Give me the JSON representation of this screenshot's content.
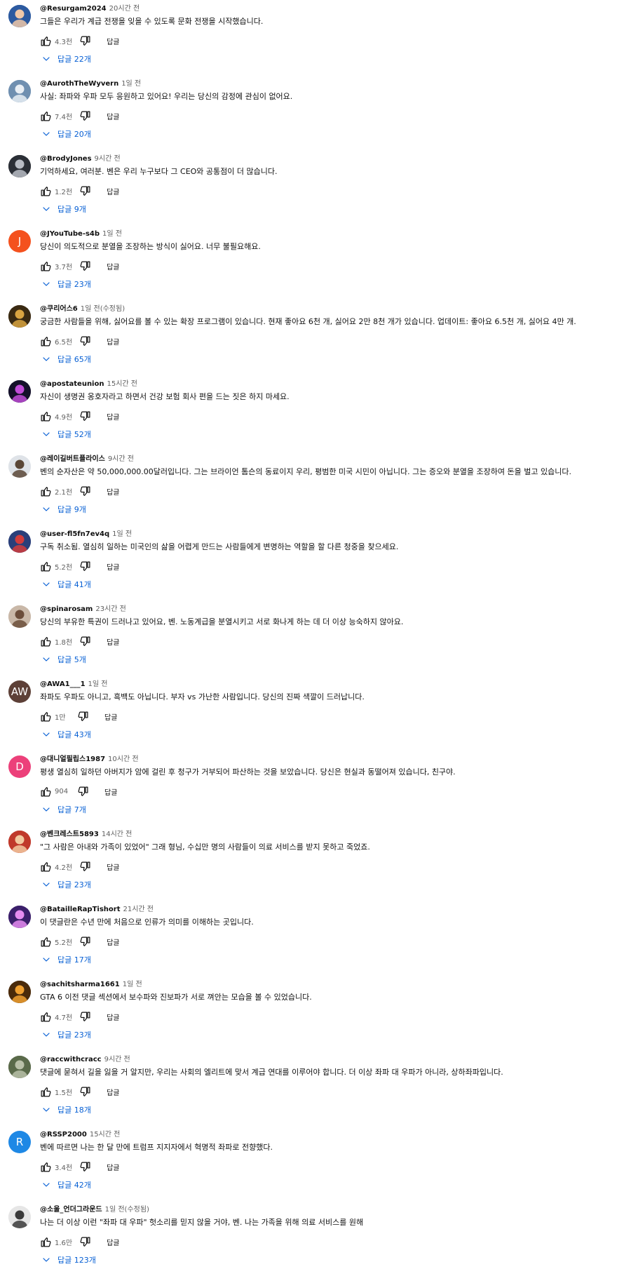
{
  "labels": {
    "reply": "답글"
  },
  "comments": [
    {
      "handle": "@Resurgam2024",
      "time": "20시간 전",
      "text": "그들은 우리가 계급 전쟁을 잊을 수 있도록 문화 전쟁을 시작했습니다.",
      "likes": "4.3천",
      "replies": "답글 22개",
      "avatar": {
        "type": "image",
        "icon": "avatar-anime-girl-icon",
        "bg": "#2c5aa0",
        "fg": "#f0c8a8"
      }
    },
    {
      "handle": "@AurothTheWyvern",
      "time": "1일 전",
      "text": "사실: 좌파와 우파 모두 응원하고 있어요! 우리는 당신의 감정에 관심이 없어요.",
      "likes": "7.4천",
      "replies": "답글 20개",
      "avatar": {
        "type": "image",
        "icon": "avatar-dragon-icon",
        "bg": "#6f8fb0",
        "fg": "#e8eef4"
      }
    },
    {
      "handle": "@BrodyJones",
      "time": "9시간 전",
      "text": "기억하세요, 여러분. 벤은 우리 누구보다 그 CEO와 공통점이 더 많습니다.",
      "likes": "1.2천",
      "replies": "답글 9개",
      "avatar": {
        "type": "image",
        "icon": "avatar-person-dark-icon",
        "bg": "#2b2f36",
        "fg": "#b8bcc4"
      }
    },
    {
      "handle": "@JYouTube-s4b",
      "time": "1일 전",
      "text": "당신이 의도적으로 분열을 조장하는 방식이 싫어요. 너무 불필요해요.",
      "likes": "3.7천",
      "replies": "답글 23개",
      "avatar": {
        "type": "letter",
        "letter": "J",
        "bg": "#f4511e"
      }
    },
    {
      "handle": "@쿠리어스6",
      "time": "1일 전(수정됨)",
      "text": "궁금한 사람들을 위해, 싫어요를 볼 수 있는 확장 프로그램이 있습니다. 현재 좋아요 6천 개, 싫어요 2만 8천 개가 있습니다. 업데이트: 좋아요 6.5천 개, 싫어요 4만 개.",
      "likes": "6.5천",
      "replies": "답글 65개",
      "avatar": {
        "type": "image",
        "icon": "avatar-cat-icon",
        "bg": "#3a2a12",
        "fg": "#d9a441"
      }
    },
    {
      "handle": "@apostateunion",
      "time": "15시간 전",
      "text": "자신이 생명권 옹호자라고 하면서 건강 보험 회사 편을 드는 짓은 하지 마세요.",
      "likes": "4.9천",
      "replies": "답글 52개",
      "avatar": {
        "type": "image",
        "icon": "avatar-dark-burst-icon",
        "bg": "#14102a",
        "fg": "#c04cd8"
      }
    },
    {
      "handle": "@레이길버트플라이스",
      "time": "9시간 전",
      "text": "벤의 순자산은 약 50,000,000.00달러입니다. 그는 브라이언 톰슨의 동료이지 우리, 평범한 미국 시민이 아닙니다. 그는 증오와 분열을 조장하여 돈을 벌고 있습니다.",
      "likes": "2.1천",
      "replies": "답글 9개",
      "avatar": {
        "type": "image",
        "icon": "avatar-person-photo-icon",
        "bg": "#dfe3e8",
        "fg": "#5a4636"
      }
    },
    {
      "handle": "@user-fl5fn7ev4q",
      "time": "1일 전",
      "text": "구독 취소됨. 열심히 일하는 미국인의 삶을 어렵게 만드는 사람들에게 변명하는 역할을 할 다른 청중을 찾으세요.",
      "likes": "5.2천",
      "replies": "답글 41개",
      "avatar": {
        "type": "image",
        "icon": "avatar-flag-person-icon",
        "bg": "#2a3f7a",
        "fg": "#d23c3c"
      }
    },
    {
      "handle": "@spinarosam",
      "time": "23시간 전",
      "text": "당신의 부유한 특권이 드러나고 있어요, 벤. 노동계급을 분열시키고 서로 화나게 하는 데 더 이상 능숙하지 않아요.",
      "likes": "1.8천",
      "replies": "답글 5개",
      "avatar": {
        "type": "image",
        "icon": "avatar-person-light-icon",
        "bg": "#c9b8a8",
        "fg": "#6b4d3a"
      }
    },
    {
      "handle": "@AWA1___1",
      "time": "1일 전",
      "text": "좌파도 우파도 아니고, 흑백도 아닙니다. 부자 vs 가난한 사람입니다. 당신의 진짜 색깔이 드러납니다.",
      "likes": "1만",
      "replies": "답글 43개",
      "avatar": {
        "type": "letter",
        "letter": "AW",
        "bg": "#5d4037"
      }
    },
    {
      "handle": "@대니얼필립스1987",
      "time": "10시간 전",
      "text": "평생 열심히 일하던 아버지가 암에 걸린 후 청구가 거부되어 파산하는 것을 보았습니다. 당신은 현실과 동떨어져 있습니다, 친구야.",
      "likes": "904",
      "replies": "답글 7개",
      "avatar": {
        "type": "letter",
        "letter": "D",
        "bg": "#ec407a"
      }
    },
    {
      "handle": "@벤크레스트5893",
      "time": "14시간 전",
      "text": "\"그 사람은 아내와 가족이 있었어\" 그래 형님, 수십만 명의 사람들이 의료 서비스를 받지 못하고 죽었죠.",
      "likes": "4.2천",
      "replies": "답글 23개",
      "avatar": {
        "type": "image",
        "icon": "avatar-person-red-icon",
        "bg": "#c0392b",
        "fg": "#f2c9a0"
      }
    },
    {
      "handle": "@BatailleRapTishort",
      "time": "21시간 전",
      "text": "이 댓글란은 수년 만에 처음으로 인류가 의미를 이해하는 곳입니다.",
      "likes": "5.2천",
      "replies": "답글 17개",
      "avatar": {
        "type": "image",
        "icon": "avatar-purple-orb-icon",
        "bg": "#3b1f6b",
        "fg": "#e58cf0"
      }
    },
    {
      "handle": "@sachitsharma1661",
      "time": "1일 전",
      "text": "GTA 6 이전 댓글 섹션에서 보수파와 진보파가 서로 껴안는 모습을 볼 수 있었습니다.",
      "likes": "4.7천",
      "replies": "답글 23개",
      "avatar": {
        "type": "image",
        "icon": "avatar-orange-figure-icon",
        "bg": "#4a2a0a",
        "fg": "#f0a030"
      }
    },
    {
      "handle": "@raccwithcracc",
      "time": "9시간 전",
      "text": "댓글에 묻혀서 길을 잃을 거 알지만, 우리는 사회의 엘리트에 맞서 계급 연대를 이루어야 합니다. 더 이상 좌파 대 우파가 아니라, 상하좌파입니다.",
      "likes": "1.5천",
      "replies": "답글 18개",
      "avatar": {
        "type": "image",
        "icon": "avatar-raccoon-icon",
        "bg": "#5a6a4a",
        "fg": "#b9c0a8"
      }
    },
    {
      "handle": "@RSSP2000",
      "time": "15시간 전",
      "text": "벤에 따르면 나는 한 달 만에 트럼프 지지자에서 혁명적 좌파로 전향했다.",
      "likes": "3.4천",
      "replies": "답글 42개",
      "avatar": {
        "type": "letter",
        "letter": "R",
        "bg": "#1e88e5"
      }
    },
    {
      "handle": "@소울_언더그라운드",
      "time": "1일 전(수정됨)",
      "text": "나는 더 이상 이런 \"좌파 대 우파\" 헛소리를 믿지 않을 거야, 벤. 나는 가족을 위해 의료 서비스를 원해",
      "likes": "1.6만",
      "replies": "답글 123개",
      "avatar": {
        "type": "image",
        "icon": "avatar-grey-character-icon",
        "bg": "#e6e6e6",
        "fg": "#3a3a3a"
      }
    }
  ]
}
